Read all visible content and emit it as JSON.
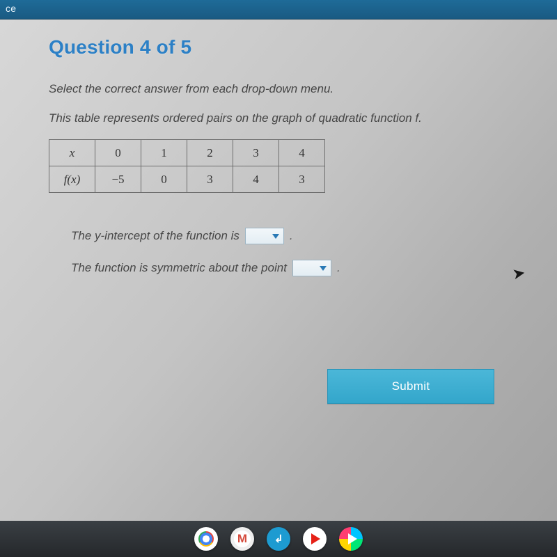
{
  "window": {
    "title_fragment": "ce"
  },
  "question": {
    "heading": "Question 4 of 5",
    "instruction": "Select the correct answer from each drop-down menu.",
    "prompt": "This table represents ordered pairs on the graph of quadratic function f."
  },
  "table": {
    "row_x_label": "x",
    "row_fx_label": "f(x)",
    "x": [
      "0",
      "1",
      "2",
      "3",
      "4"
    ],
    "fx": [
      "−5",
      "0",
      "3",
      "4",
      "3"
    ]
  },
  "answers": {
    "line1_text": "The y-intercept of the function is",
    "line1_suffix": ".",
    "line2_text": "The function is symmetric about the point",
    "line2_suffix": ".",
    "dropdown1_value": "",
    "dropdown2_value": ""
  },
  "buttons": {
    "submit": "Submit"
  },
  "taskbar": {
    "icons": [
      "chrome",
      "gmail",
      "docs",
      "youtube",
      "play"
    ]
  }
}
